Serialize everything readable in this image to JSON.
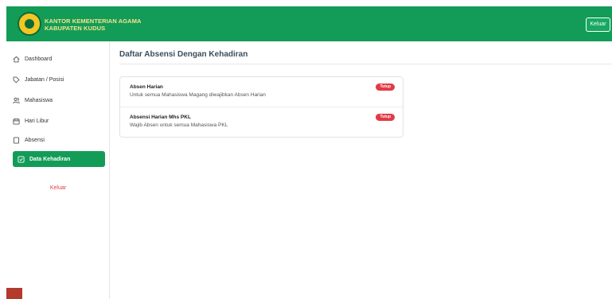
{
  "header": {
    "brand_line1": "KANTOR KEMENTERIAN AGAMA",
    "brand_line2": "KABUPATEN KUDUS",
    "logout_label": "Keluar"
  },
  "sidebar": {
    "items": [
      {
        "label": "Dashboard",
        "icon": "home-icon",
        "active": false
      },
      {
        "label": "Jabatan / Posisi",
        "icon": "tag-icon",
        "active": false
      },
      {
        "label": "Mahasiswa",
        "icon": "users-icon",
        "active": false
      },
      {
        "label": "Hari Libur",
        "icon": "calendar-icon",
        "active": false
      },
      {
        "label": "Absensi",
        "icon": "file-icon",
        "active": false
      },
      {
        "label": "Data Kehadiran",
        "icon": "checklist-icon",
        "active": true
      }
    ],
    "logout_label": "Keluar"
  },
  "main": {
    "title": "Daftar Absensi Dengan Kehadiran",
    "rows": [
      {
        "title": "Absen Harian",
        "description": "Untuk semua Mahasiswa Magang diwajibkan Absen Harian",
        "status": "Tutup"
      },
      {
        "title": "Absensi Harian Mhs PKL",
        "description": "Wajib Absen untuk semua Mahasiswa PKL",
        "status": "Tutup"
      }
    ]
  },
  "colors": {
    "brand_green": "#139c58",
    "badge_red": "#e23a45",
    "logout_red": "#e33b3b"
  }
}
